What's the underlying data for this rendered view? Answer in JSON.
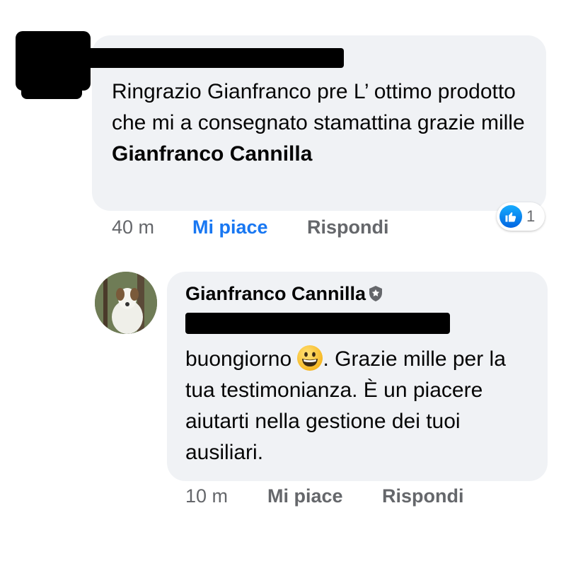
{
  "comment1": {
    "text_plain": "Ringrazio Gianfranco pre L’ ottimo prodotto che mi a consegnato stamattina grazie mille ",
    "mention": "Gianfranco Cannilla",
    "meta": {
      "time": "40 m",
      "like": "Mi piace",
      "reply": "Rispondi"
    },
    "reaction": {
      "icon": "like-icon",
      "count": "1",
      "color": "#1877f2"
    }
  },
  "comment2": {
    "author": "Gianfranco Cannilla",
    "author_badge_icon": "shield-icon",
    "text_before_emoji": "buongiorno ",
    "emoji_icon": "grinning-face-icon",
    "text_after_emoji": ". Grazie mille per la tua testimonianza. È un piacere aiutarti nella gestione dei tuoi ausiliari.",
    "meta": {
      "time": "10 m",
      "like": "Mi piace",
      "reply": "Rispondi"
    }
  },
  "colors": {
    "bubble": "#f0f2f5",
    "text": "#050505",
    "secondary": "#65676b",
    "liked": "#1877f2"
  }
}
